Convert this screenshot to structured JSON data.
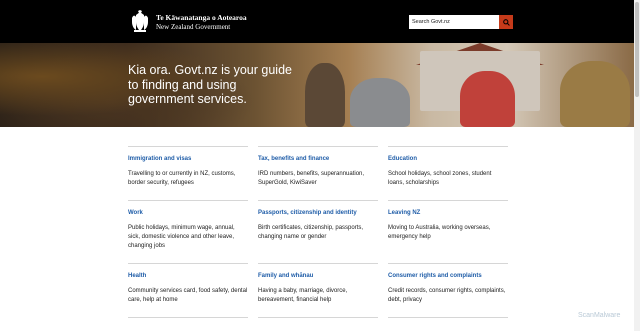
{
  "header": {
    "maori_name": "Te Kāwanatanga o Aotearoa",
    "english_name": "New Zealand Government"
  },
  "search": {
    "placeholder": "Search Govt.nz",
    "button_icon": "search-icon"
  },
  "hero": {
    "title": "Kia ora. Govt.nz is your guide to finding and using government services."
  },
  "topics": [
    {
      "title": "Immigration and visas",
      "desc": "Travelling to or currently in NZ, customs, border security, refugees"
    },
    {
      "title": "Tax, benefits and finance",
      "desc": "IRD numbers, benefits, superannuation, SuperGold, KiwiSaver"
    },
    {
      "title": "Education",
      "desc": "School holidays, school zones, student loans, scholarships"
    },
    {
      "title": "Work",
      "desc": "Public holidays, minimum wage, annual, sick, domestic violence and other leave, changing jobs"
    },
    {
      "title": "Passports, citizenship and identity",
      "desc": "Birth certificates, citizenship, passports, changing name or gender"
    },
    {
      "title": "Leaving NZ",
      "desc": "Moving to Australia, working overseas, emergency help"
    },
    {
      "title": "Health",
      "desc": "Community services card, food safety, dental care, help at home"
    },
    {
      "title": "Family and whānau",
      "desc": "Having a baby, marriage, divorce, bereavement, financial help"
    },
    {
      "title": "Consumer rights and complaints",
      "desc": "Credit records, consumer rights, complaints, debt, privacy"
    }
  ],
  "watermark": "ScanMalware"
}
